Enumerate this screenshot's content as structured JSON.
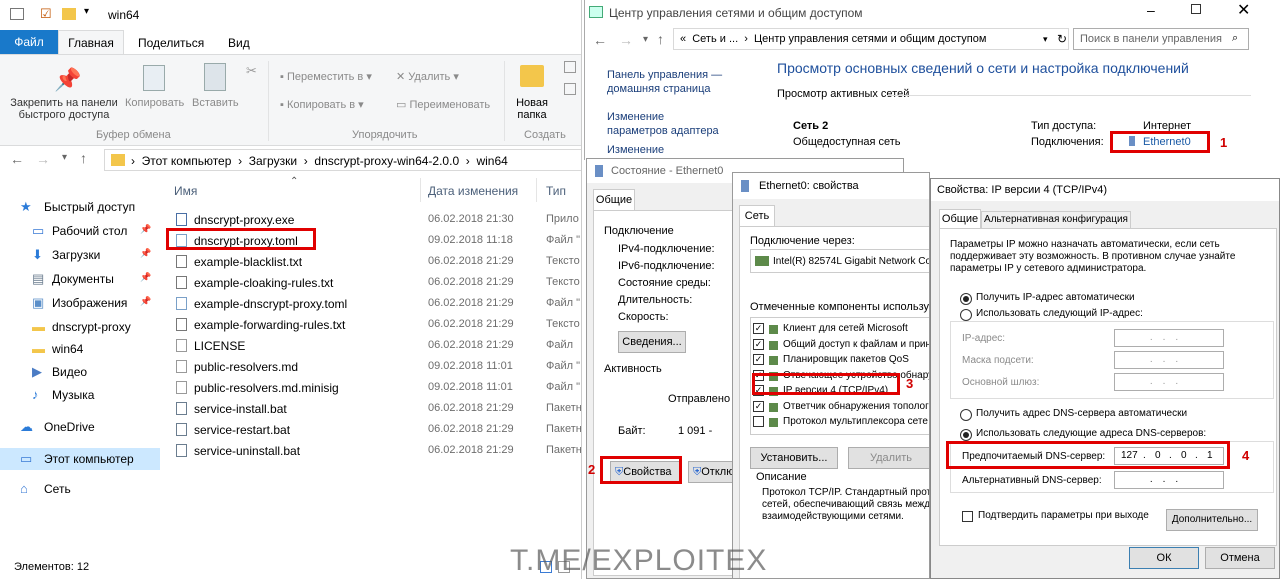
{
  "explorer": {
    "title": "win64",
    "ribbon_tabs": [
      "Файл",
      "Главная",
      "Поделиться",
      "Вид"
    ],
    "ribbon": {
      "pin": "Закрепить на панели\nбыстрого доступа",
      "copy": "Копировать",
      "paste": "Вставить",
      "clipboard_group": "Буфер обмена",
      "move_to": "Переместить в",
      "copy_to": "Копировать в",
      "delete": "Удалить",
      "rename": "Переименовать",
      "organize_group": "Упорядочить",
      "new_folder": "Новая\nпапка",
      "create_group": "Создать"
    },
    "path": [
      "Этот компьютер",
      "Загрузки",
      "dnscrypt-proxy-win64-2.0.0",
      "win64"
    ],
    "columns": {
      "name": "Имя",
      "date": "Дата изменения",
      "type": "Тип"
    },
    "nav": [
      {
        "label": "Быстрый доступ",
        "icon": "star-icon"
      },
      {
        "label": "Рабочий стол",
        "icon": "desktop-icon",
        "pin": true
      },
      {
        "label": "Загрузки",
        "icon": "download-icon",
        "pin": true
      },
      {
        "label": "Документы",
        "icon": "documents-icon",
        "pin": true
      },
      {
        "label": "Изображения",
        "icon": "pictures-icon",
        "pin": true
      },
      {
        "label": "dnscrypt-proxy",
        "icon": "folder-icon"
      },
      {
        "label": "win64",
        "icon": "folder-icon"
      },
      {
        "label": "Видео",
        "icon": "video-icon"
      },
      {
        "label": "Музыка",
        "icon": "music-icon"
      },
      {
        "label": "OneDrive",
        "icon": "cloud-icon"
      },
      {
        "label": "Этот компьютер",
        "icon": "computer-icon"
      },
      {
        "label": "Сеть",
        "icon": "network-icon"
      }
    ],
    "files": [
      {
        "name": "dnscrypt-proxy.exe",
        "date": "06.02.2018 21:30",
        "type": "Прило",
        "icon": "exe-icon"
      },
      {
        "name": "dnscrypt-proxy.toml",
        "date": "09.02.2018 11:18",
        "type": "Файл \"",
        "icon": "toml-file-icon"
      },
      {
        "name": "example-blacklist.txt",
        "date": "06.02.2018 21:29",
        "type": "Тексто",
        "icon": "text-file-icon"
      },
      {
        "name": "example-cloaking-rules.txt",
        "date": "06.02.2018 21:29",
        "type": "Тексто",
        "icon": "text-file-icon"
      },
      {
        "name": "example-dnscrypt-proxy.toml",
        "date": "06.02.2018 21:29",
        "type": "Файл \"",
        "icon": "toml-file-icon"
      },
      {
        "name": "example-forwarding-rules.txt",
        "date": "06.02.2018 21:29",
        "type": "Тексто",
        "icon": "text-file-icon"
      },
      {
        "name": "LICENSE",
        "date": "06.02.2018 21:29",
        "type": "Файл",
        "icon": "blank-file-icon"
      },
      {
        "name": "public-resolvers.md",
        "date": "09.02.2018 11:01",
        "type": "Файл \"",
        "icon": "blank-file-icon"
      },
      {
        "name": "public-resolvers.md.minisig",
        "date": "09.02.2018 11:01",
        "type": "Файл \"",
        "icon": "blank-file-icon"
      },
      {
        "name": "service-install.bat",
        "date": "06.02.2018 21:29",
        "type": "Пакетн",
        "icon": "bat-file-icon"
      },
      {
        "name": "service-restart.bat",
        "date": "06.02.2018 21:29",
        "type": "Пакетн",
        "icon": "bat-file-icon"
      },
      {
        "name": "service-uninstall.bat",
        "date": "06.02.2018 21:29",
        "type": "Пакетн",
        "icon": "bat-file-icon"
      }
    ],
    "status": "Элементов: 12"
  },
  "netcenter": {
    "title": "Центр управления сетями и общим доступом",
    "crumb1": "Сеть и ...",
    "crumb2": "Центр управления сетями и общим доступом",
    "search_placeholder": "Поиск в панели управления",
    "side": [
      "Панель управления — домашняя страница",
      "Изменение параметров адаптера",
      "Изменение дополнительных"
    ],
    "heading": "Просмотр основных сведений о сети и настройка подключений",
    "active_label": "Просмотр активных сетей",
    "network_name": "Сеть  2",
    "network_type": "Общедоступная сеть",
    "access_label": "Тип доступа:",
    "access_value": "Интернет",
    "conn_label": "Подключения:",
    "conn_value": "Ethernet0"
  },
  "status_win": {
    "title": "Состояние - Ethernet0",
    "tab": "Общие",
    "conn_header": "Подключение",
    "ipv4": "IPv4-подключение:",
    "ipv6": "IPv6-подключение:",
    "media": "Состояние среды:",
    "duration": "Длительность:",
    "speed": "Скорость:",
    "details": "Сведения...",
    "activity": "Активность",
    "sent": "Отправлено",
    "bytes_label": "Байт:",
    "bytes_value": "1 091 -",
    "properties": "Свойства",
    "disable": "Отклю"
  },
  "props_win": {
    "title": "Ethernet0: свойства",
    "tab": "Сеть",
    "connect_via": "Подключение через:",
    "adapter": "Intel(R) 82574L Gigabit Network Con",
    "components_label": "Отмеченные компоненты используются",
    "components": [
      {
        "label": "Клиент для сетей Microsoft",
        "checked": true
      },
      {
        "label": "Общий доступ к файлам и принт",
        "checked": true
      },
      {
        "label": "Планировщик пакетов QoS",
        "checked": true
      },
      {
        "label": "Отвечающее устройство обнару",
        "checked": true
      },
      {
        "label": "IP версии 4 (TCP/IPv4)",
        "checked": true
      },
      {
        "label": "Ответчик обнаружения тополог",
        "checked": true
      },
      {
        "label": "Протокол мультиплексора сете",
        "checked": false
      }
    ],
    "install": "Установить...",
    "remove": "Удалить",
    "desc_header": "Описание",
    "desc_text": "Протокол TCP/IP. Стандартный прото\nсетей, обеспечивающий связь межд\nвзаимодействующими сетями."
  },
  "ipv4_win": {
    "title": "Свойства: IP версии 4 (TCP/IPv4)",
    "tab_general": "Общие",
    "tab_alt": "Альтернативная конфигурация",
    "intro": "Параметры IP можно назначать автоматически, если сеть\nподдерживает эту возможность. В противном случае узнайте\nпараметры IP у сетевого администратора.",
    "auto_ip": "Получить IP-адрес автоматически",
    "manual_ip": "Использовать следующий IP-адрес:",
    "ip_label": "IP-адрес:",
    "mask_label": "Маска подсети:",
    "gw_label": "Основной шлюз:",
    "auto_dns": "Получить адрес DNS-сервера автоматически",
    "manual_dns": "Использовать следующие адреса DNS-серверов:",
    "pref_dns_label": "Предпочитаемый DNS-сервер:",
    "pref_dns": [
      "127",
      "0",
      "0",
      "1"
    ],
    "alt_dns_label": "Альтернативный DNS-сервер:",
    "confirm": "Подтвердить параметры при выходе",
    "advanced": "Дополнительно...",
    "ok": "ОК",
    "cancel": "Отмена"
  },
  "markers": [
    "1",
    "2",
    "3",
    "4"
  ],
  "watermark": "T.ME/EXPLOITEX"
}
